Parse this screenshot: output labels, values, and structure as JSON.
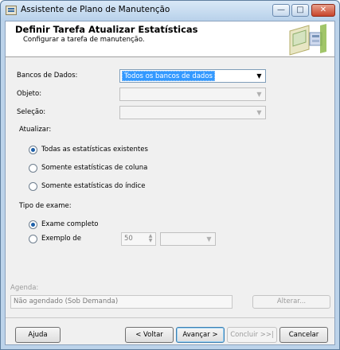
{
  "window": {
    "title": "Assistente de Plano de Manutenção",
    "controls": {
      "minimize": "—",
      "maximize": "□",
      "close": "✕"
    }
  },
  "header": {
    "title": "Definir Tarefa Atualizar Estatísticas",
    "subtitle": "Configurar a tarefa de manutenção."
  },
  "fields": {
    "databases": {
      "label": "Bancos de Dados:",
      "value": "Todos os bancos de dados"
    },
    "object": {
      "label": "Objeto:",
      "value": ""
    },
    "selection": {
      "label": "Seleção:",
      "value": ""
    }
  },
  "update": {
    "label": "Atualizar:",
    "options": [
      {
        "label": "Todas as estatísticas existentes",
        "selected": true
      },
      {
        "label": "Somente estatísticas de coluna",
        "selected": false
      },
      {
        "label": "Somente estatísticas do índice",
        "selected": false
      }
    ]
  },
  "scan": {
    "label": "Tipo de exame:",
    "options": [
      {
        "label": "Exame completo",
        "selected": true
      },
      {
        "label": "Exemplo de",
        "selected": false
      }
    ],
    "sample_value": "50",
    "sample_unit": ""
  },
  "schedule": {
    "label": "Agenda:",
    "value": "Não agendado (Sob Demanda)",
    "change_button": "Alterar..."
  },
  "buttons": {
    "help": "Ajuda",
    "back": "< Voltar",
    "next": "Avançar >",
    "finish": "Concluir >>|",
    "cancel": "Cancelar"
  },
  "colors": {
    "selection": "#3399ff",
    "window_frame": "#bcd3ea"
  }
}
